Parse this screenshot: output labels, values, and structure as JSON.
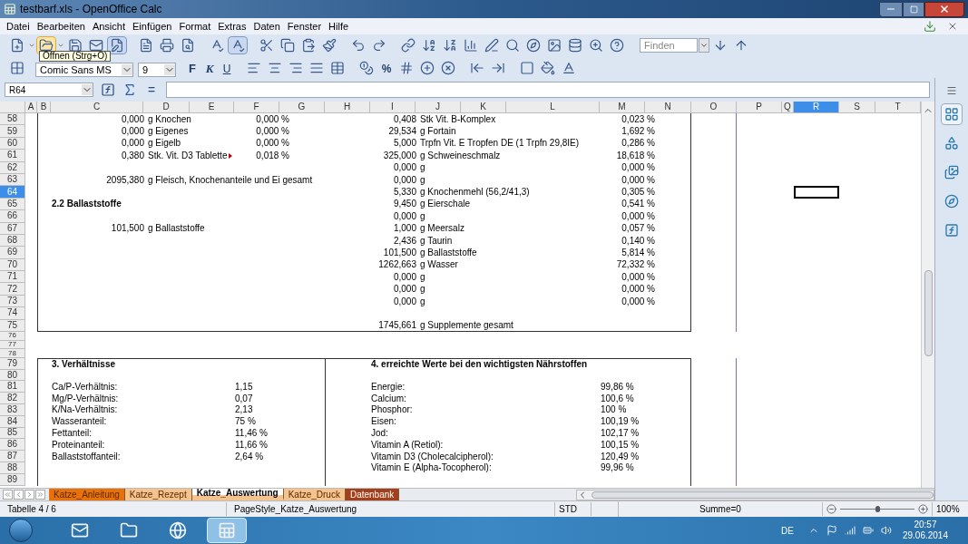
{
  "window": {
    "title": "testbarf.xls - OpenOffice Calc"
  },
  "menu": [
    "Datei",
    "Bearbeiten",
    "Ansicht",
    "Einfügen",
    "Format",
    "Extras",
    "Daten",
    "Fenster",
    "Hilfe"
  ],
  "standard_toolbar": {
    "open_hovered": true,
    "edit_mode_pressed": true,
    "autospellcheck_pressed": true
  },
  "find_box": {
    "placeholder": "Finden"
  },
  "tooltip": "Öffnen (Strg+O)",
  "format_toolbar": {
    "font_name": "Comic Sans MS",
    "font_size": "9",
    "bold": "F",
    "italic": "K",
    "underline": "U",
    "percent": "%"
  },
  "formula_bar": {
    "name_box": "R64",
    "equals": "="
  },
  "columns": [
    {
      "label": "A",
      "selected": false
    },
    {
      "label": "B",
      "selected": false
    },
    {
      "label": "C",
      "selected": false
    },
    {
      "label": "D",
      "selected": false
    },
    {
      "label": "E",
      "selected": false
    },
    {
      "label": "F",
      "selected": false
    },
    {
      "label": "G",
      "selected": false
    },
    {
      "label": "H",
      "selected": false
    },
    {
      "label": "I",
      "selected": false
    },
    {
      "label": "J",
      "selected": false
    },
    {
      "label": "K",
      "selected": false
    },
    {
      "label": "L",
      "selected": false
    },
    {
      "label": "M",
      "selected": false
    },
    {
      "label": "N",
      "selected": false
    },
    {
      "label": "O",
      "selected": false
    },
    {
      "label": "P",
      "selected": false
    },
    {
      "label": "Q",
      "selected": false
    },
    {
      "label": "R",
      "selected": true
    },
    {
      "label": "S",
      "selected": false
    },
    {
      "label": "T",
      "selected": false
    }
  ],
  "section_1": [
    {
      "number": "58",
      "selected": false,
      "left": {
        "amount": "0,000",
        "label": "g Knochen",
        "percent": "0,000 %"
      },
      "right": {
        "amount": "0,408",
        "label": "Stk Vit. B-Komplex",
        "percent": "0,023 %"
      }
    },
    {
      "number": "59",
      "selected": false,
      "left": {
        "amount": "0,000",
        "label": "g Eigenes",
        "percent": "0,000 %"
      },
      "right": {
        "amount": "29,534",
        "label": "g Fortain",
        "percent": "1,692 %"
      }
    },
    {
      "number": "60",
      "selected": false,
      "left": {
        "amount": "0,000",
        "label": "g Eigelb",
        "percent": "0,000 %"
      },
      "right": {
        "amount": "5,000",
        "label": "Trpfn Vit. E Tropfen DE (1 Trpfn 29,8IE)",
        "percent": "0,286 %"
      }
    },
    {
      "number": "61",
      "selected": false,
      "left": {
        "amount": "0,380",
        "label": "Stk. Vit. D3 Tablette",
        "overflow": true,
        "percent": "0,018 %"
      },
      "right": {
        "amount": "325,000",
        "label": "g Schweineschmalz",
        "percent": "18,618 %"
      }
    },
    {
      "number": "62",
      "selected": false,
      "right": {
        "amount": "0,000",
        "label": "g",
        "percent": "0,000 %"
      }
    },
    {
      "number": "63",
      "selected": false,
      "left": {
        "amount": "2095,380",
        "label": "g Fleisch, Knochenanteile und Ei gesamt"
      },
      "right": {
        "amount": "0,000",
        "label": "g",
        "percent": "0,000 %"
      }
    },
    {
      "number": "64",
      "selected": true,
      "right": {
        "amount": "5,330",
        "label": "g Knochenmehl (56,2/41,3)",
        "percent": "0,305 %"
      }
    },
    {
      "number": "65",
      "selected": false,
      "heading": "2.2 Ballaststoffe",
      "right": {
        "amount": "9,450",
        "label": "g Eierschale",
        "percent": "0,541 %"
      }
    },
    {
      "number": "66",
      "selected": false,
      "right": {
        "amount": "0,000",
        "label": "g",
        "percent": "0,000 %"
      }
    },
    {
      "number": "67",
      "selected": false,
      "left": {
        "amount": "101,500",
        "label": "g Ballaststoffe"
      },
      "right": {
        "amount": "1,000",
        "label": "g Meersalz",
        "percent": "0,057 %"
      }
    },
    {
      "number": "68",
      "selected": false,
      "right": {
        "amount": "2,436",
        "label": "g Taurin",
        "percent": "0,140 %"
      }
    },
    {
      "number": "69",
      "selected": false,
      "right": {
        "amount": "101,500",
        "label": "g Ballaststoffe",
        "percent": "5,814 %"
      }
    },
    {
      "number": "70",
      "selected": false,
      "right": {
        "amount": "1262,663",
        "label": "g Wasser",
        "percent": "72,332 %"
      }
    },
    {
      "number": "71",
      "selected": false,
      "right": {
        "amount": "0,000",
        "label": "g",
        "percent": "0,000 %"
      }
    },
    {
      "number": "72",
      "selected": false,
      "right": {
        "amount": "0,000",
        "label": "g",
        "percent": "0,000 %"
      }
    },
    {
      "number": "73",
      "selected": false,
      "right": {
        "amount": "0,000",
        "label": "g",
        "percent": "0,000 %"
      }
    },
    {
      "number": "74",
      "selected": false
    },
    {
      "number": "75",
      "selected": false,
      "right": {
        "amount": "1745,661",
        "label": "g Supplemente gesamt"
      }
    }
  ],
  "spacer_rows": [
    {
      "number": "76",
      "selected": false
    },
    {
      "number": "77",
      "selected": false
    },
    {
      "number": "78",
      "selected": false
    }
  ],
  "section_2": [
    {
      "number": "79",
      "selected": false,
      "left_heading": "3. Verhältnisse",
      "right_heading": "4. erreichte Werte bei den wichtigsten Nährstoffen"
    },
    {
      "number": "80",
      "selected": false
    },
    {
      "number": "81",
      "selected": false,
      "left": {
        "label": "Ca/P-Verhältnis:",
        "value": "1,15"
      },
      "right": {
        "label": "Energie:",
        "value": "99,86 %"
      }
    },
    {
      "number": "82",
      "selected": false,
      "left": {
        "label": "Mg/P-Verhältnis:",
        "value": "0,07"
      },
      "right": {
        "label": "Calcium:",
        "value": "100,6 %"
      }
    },
    {
      "number": "83",
      "selected": false,
      "left": {
        "label": "K/Na-Verhältnis:",
        "value": "2,13"
      },
      "right": {
        "label": "Phosphor:",
        "value": "100 %"
      }
    },
    {
      "number": "84",
      "selected": false,
      "left": {
        "label": "Wasseranteil:",
        "value": "75 %"
      },
      "right": {
        "label": "Eisen:",
        "value": "100,19 %"
      }
    },
    {
      "number": "85",
      "selected": false,
      "left": {
        "label": "Fettanteil:",
        "value": "11,46 %"
      },
      "right": {
        "label": "Jod:",
        "value": "102,17 %"
      }
    },
    {
      "number": "86",
      "selected": false,
      "left": {
        "label": "Proteinanteil:",
        "value": "11,66 %"
      },
      "right": {
        "label": "Vitamin A (Retiol):",
        "value": "100,15 %"
      }
    },
    {
      "number": "87",
      "selected": false,
      "left": {
        "label": "Ballaststoffanteil:",
        "value": "2,64 %"
      },
      "right": {
        "label": "Vitamin D3 (Cholecalcipherol):",
        "value": "120,49 %"
      }
    },
    {
      "number": "88",
      "selected": false,
      "right": {
        "label": "Vitamin E (Alpha-Tocopherol):",
        "value": "99,96 %"
      }
    },
    {
      "number": "89",
      "selected": false
    }
  ],
  "sheet_tabs": [
    {
      "label": "Katze_Anleitung",
      "selected": false,
      "color": "#e8710a"
    },
    {
      "label": "Katze_Rezept",
      "selected": false,
      "color": "#f5c48e"
    },
    {
      "label": "Katze_Auswertung",
      "selected": true,
      "color": "#f5c48e"
    },
    {
      "label": "Katze_Druck",
      "selected": false,
      "color": "#f5c48e"
    },
    {
      "label": "Datenbank",
      "selected": false,
      "color": "#a3401b"
    }
  ],
  "sidebar": [
    {
      "selected": true
    },
    {
      "selected": false
    },
    {
      "selected": false
    },
    {
      "selected": false
    },
    {
      "selected": false
    }
  ],
  "status_bar": {
    "sheet": "Tabelle 4 / 6",
    "page_style": "PageStyle_Katze_Auswertung",
    "mode": "STD",
    "sum": "Summe=0",
    "zoom": {
      "level": 0.5
    },
    "zoom_text": "100%"
  },
  "taskbar": {
    "apps": [
      {
        "active": false
      },
      {
        "active": false
      },
      {
        "active": false
      },
      {
        "active": true
      }
    ],
    "language": "DE",
    "time": "20:57",
    "date": "29.06.2014"
  }
}
